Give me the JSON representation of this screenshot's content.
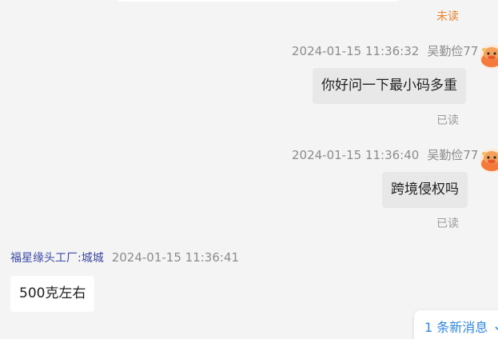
{
  "messages": [
    {
      "read_status": "未读"
    },
    {
      "timestamp": "2024-01-15 11:36:32",
      "sender": "吴勤俭77",
      "text": "你好问一下最小码多重",
      "read_status": "已读"
    },
    {
      "timestamp": "2024-01-15 11:36:40",
      "sender": "吴勤俭77",
      "text": "跨境侵权吗",
      "read_status": "已读"
    },
    {
      "sender": "福星缘头工厂:城城",
      "timestamp": "2024-01-15 11:36:41",
      "text": "500克左右"
    }
  ],
  "new_messages_label": "1 条新消息",
  "colors": {
    "background": "#f4f4f4",
    "sent_bubble": "#e8e8e8",
    "received_bubble": "#ffffff",
    "unread": "#e8842c",
    "sender_link": "#3d4aa8",
    "notice": "#2f88e8"
  },
  "icons": {
    "avatar": "cartoon-cow-avatar-icon",
    "new_messages": "chevron-down-icon"
  }
}
